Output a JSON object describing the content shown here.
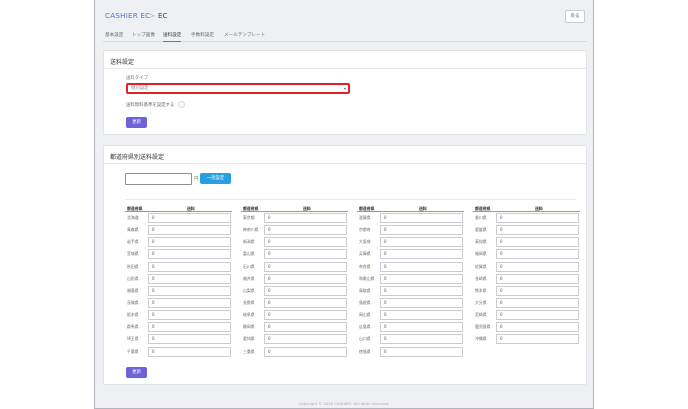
{
  "header": {
    "app_name": "CASHIER EC",
    "separator": ">",
    "page_name": "EC",
    "back_label": "戻る"
  },
  "tabs": [
    {
      "label": "基本設定",
      "active": false
    },
    {
      "label": "トップ画像",
      "active": false
    },
    {
      "label": "送料設定",
      "active": true
    },
    {
      "label": "手数料設定",
      "active": false
    },
    {
      "label": "メールテンプレート",
      "active": false
    }
  ],
  "shipping": {
    "title": "送料設定",
    "type_label": "送料タイプ",
    "type_value": "個別設定",
    "free_threshold_label": "送料無料基準を設定する",
    "update_label": "更新"
  },
  "prefecture": {
    "title": "都道府県別送料設定",
    "bulk_unit": "円",
    "bulk_button": "一括設定",
    "col_pref": "都道府県",
    "col_fee": "送料",
    "update_label": "更新",
    "columns": [
      [
        {
          "name": "北海道",
          "value": "0"
        },
        {
          "name": "青森県",
          "value": "0"
        },
        {
          "name": "岩手県",
          "value": "0"
        },
        {
          "name": "宮城県",
          "value": "0"
        },
        {
          "name": "秋田県",
          "value": "0"
        },
        {
          "name": "山形県",
          "value": "0"
        },
        {
          "name": "福島県",
          "value": "0"
        },
        {
          "name": "茨城県",
          "value": "0"
        },
        {
          "name": "栃木県",
          "value": "0"
        },
        {
          "name": "群馬県",
          "value": "0"
        },
        {
          "name": "埼玉県",
          "value": "0"
        },
        {
          "name": "千葉県",
          "value": "0"
        }
      ],
      [
        {
          "name": "東京都",
          "value": "0"
        },
        {
          "name": "神奈川県",
          "value": "0"
        },
        {
          "name": "新潟県",
          "value": "0"
        },
        {
          "name": "富山県",
          "value": "0"
        },
        {
          "name": "石川県",
          "value": "0"
        },
        {
          "name": "福井県",
          "value": "0"
        },
        {
          "name": "山梨県",
          "value": "0"
        },
        {
          "name": "長野県",
          "value": "0"
        },
        {
          "name": "岐阜県",
          "value": "0"
        },
        {
          "name": "静岡県",
          "value": "0"
        },
        {
          "name": "愛知県",
          "value": "0"
        },
        {
          "name": "三重県",
          "value": "0"
        }
      ],
      [
        {
          "name": "滋賀県",
          "value": "0"
        },
        {
          "name": "京都府",
          "value": "0"
        },
        {
          "name": "大阪府",
          "value": "0"
        },
        {
          "name": "兵庫県",
          "value": "0"
        },
        {
          "name": "奈良県",
          "value": "0"
        },
        {
          "name": "和歌山県",
          "value": "0"
        },
        {
          "name": "鳥取県",
          "value": "0"
        },
        {
          "name": "島根県",
          "value": "0"
        },
        {
          "name": "岡山県",
          "value": "0"
        },
        {
          "name": "広島県",
          "value": "0"
        },
        {
          "name": "山口県",
          "value": "0"
        },
        {
          "name": "徳島県",
          "value": "0"
        }
      ],
      [
        {
          "name": "香川県",
          "value": "0"
        },
        {
          "name": "愛媛県",
          "value": "0"
        },
        {
          "name": "高知県",
          "value": "0"
        },
        {
          "name": "福岡県",
          "value": "0"
        },
        {
          "name": "佐賀県",
          "value": "0"
        },
        {
          "name": "長崎県",
          "value": "0"
        },
        {
          "name": "熊本県",
          "value": "0"
        },
        {
          "name": "大分県",
          "value": "0"
        },
        {
          "name": "宮崎県",
          "value": "0"
        },
        {
          "name": "鹿児島県",
          "value": "0"
        },
        {
          "name": "沖縄県",
          "value": "0"
        }
      ]
    ]
  },
  "footer": {
    "copyright": "Copyright © 2025 CASHIER. All rights reserved."
  }
}
